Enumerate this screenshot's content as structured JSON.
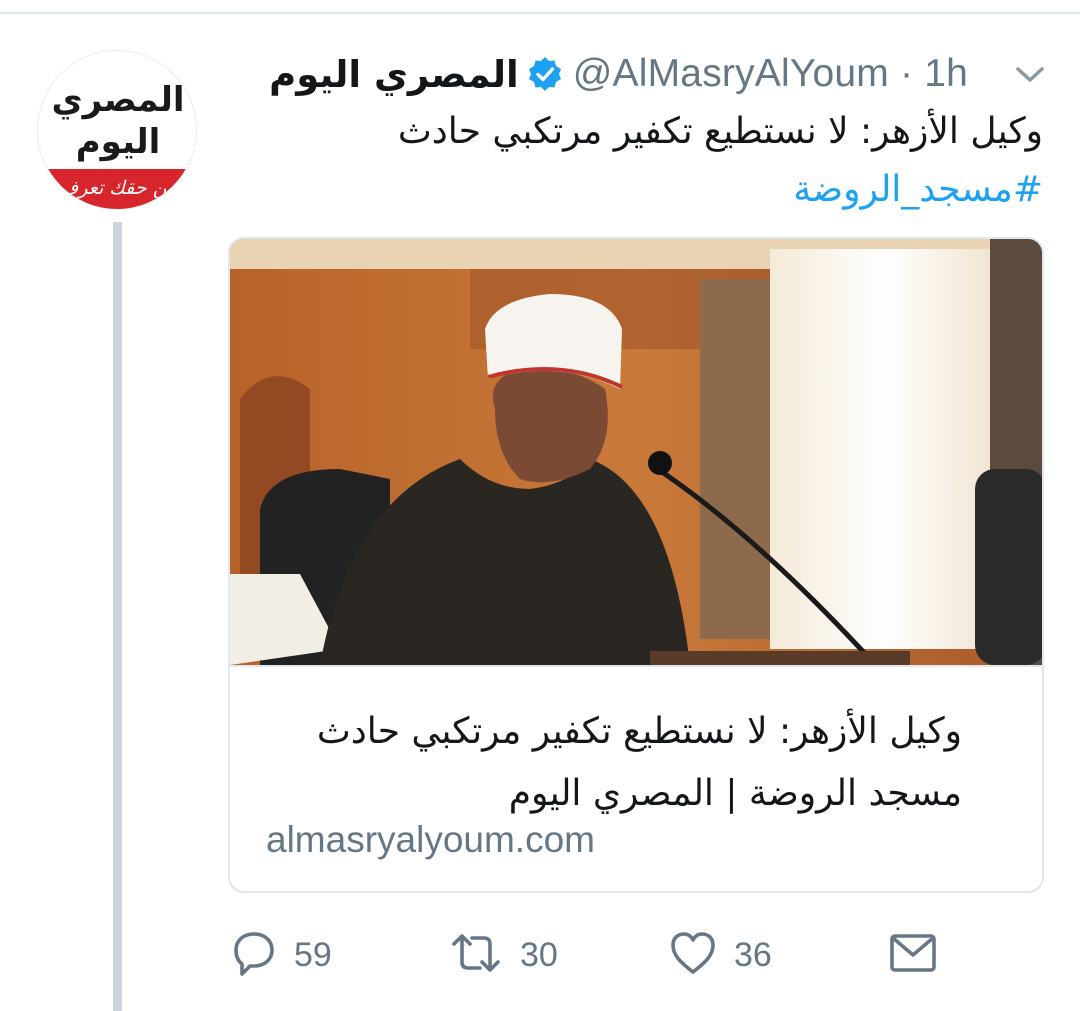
{
  "tweet": {
    "display_name": "المصري اليوم",
    "handle_time": "@AlMasryAlYoum · 1h",
    "text": "وكيل الأزهر: لا نستطيع تكفير مرتكبي حادث",
    "hashtag": "#مسجد_الروضة",
    "avatar": {
      "line1": "المصري",
      "line2": "اليوم",
      "tagline": "من حقك تعرف"
    }
  },
  "card": {
    "title": "وكيل الأزهر: لا نستطيع تكفير مرتكبي حادث مسجد الروضة | المصري اليوم",
    "domain": "almasryalyoum.com"
  },
  "actions": {
    "replies": "59",
    "retweets": "30",
    "likes": "36"
  },
  "colors": {
    "accent": "#1da1f2",
    "muted": "#657786",
    "border": "#e1e8ed",
    "brand_red": "#d6262b"
  },
  "icons": [
    "verified-badge-icon",
    "chevron-down-icon",
    "reply-icon",
    "retweet-icon",
    "like-icon",
    "direct-message-icon"
  ]
}
